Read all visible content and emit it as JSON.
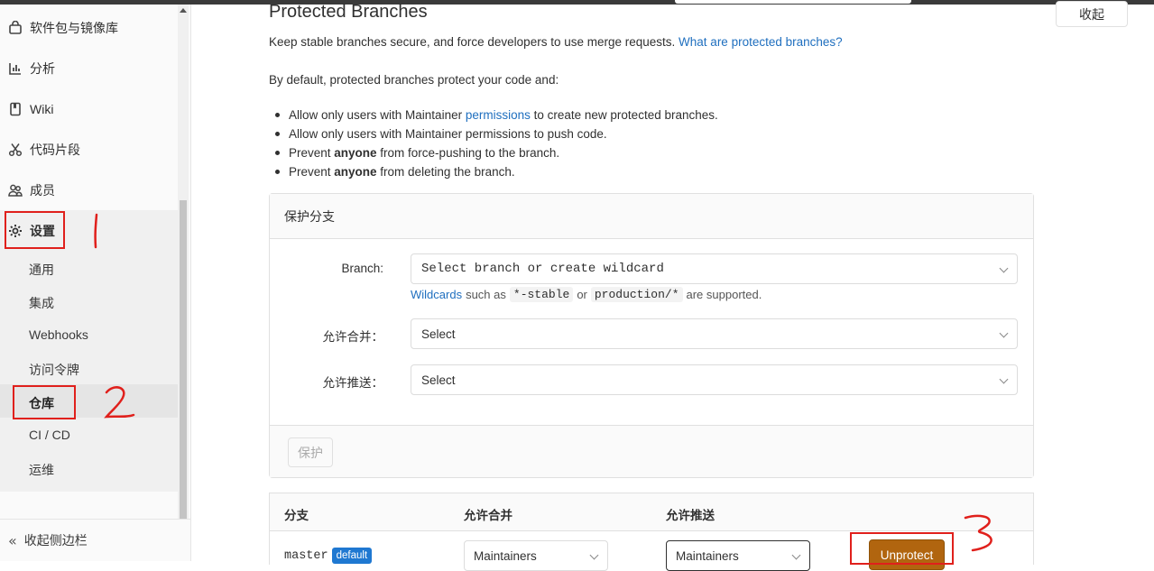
{
  "sidebar": {
    "items": [
      {
        "label": "软件包与镜像库",
        "icon": "package-icon"
      },
      {
        "label": "分析",
        "icon": "chart-icon"
      },
      {
        "label": "Wiki",
        "icon": "book-icon"
      },
      {
        "label": "代码片段",
        "icon": "scissors-icon"
      },
      {
        "label": "成员",
        "icon": "users-icon"
      },
      {
        "label": "设置",
        "icon": "gear-icon"
      }
    ],
    "sub_items": [
      {
        "label": "通用"
      },
      {
        "label": "集成"
      },
      {
        "label": "Webhooks"
      },
      {
        "label": "访问令牌"
      },
      {
        "label": "仓库"
      },
      {
        "label": "CI / CD"
      },
      {
        "label": "运维"
      }
    ],
    "collapse_label": "收起侧边栏"
  },
  "section": {
    "title": "Protected Branches",
    "collapse_button": "收起",
    "description": "Keep stable branches secure, and force developers to use merge requests.",
    "description_link": "What are protected branches?",
    "default_text": "By default, protected branches protect your code and:",
    "rules": [
      {
        "before": "Allow only users with Maintainer ",
        "link": "permissions",
        "after": " to create new protected branches."
      },
      {
        "before": "Allow only users with Maintainer permissions to push code.",
        "bold": "",
        "after": ""
      },
      {
        "before": "Prevent ",
        "bold": "anyone",
        "after": " from force-pushing to the branch."
      },
      {
        "before": "Prevent ",
        "bold": "anyone",
        "after": " from deleting the branch."
      }
    ]
  },
  "form": {
    "header": "保护分支",
    "branch_label": "Branch:",
    "branch_placeholder": "Select branch or create wildcard",
    "hint_link": "Wildcards",
    "hint_text1": "such as",
    "hint_code1": "*-stable",
    "hint_text2": "or",
    "hint_code2": "production/*",
    "hint_text3": "are supported.",
    "merge_label": "允许合并：",
    "merge_value": "Select",
    "push_label": "允许推送：",
    "push_value": "Select",
    "protect_button": "保护"
  },
  "table": {
    "headers": [
      "分支",
      "允许合并",
      "允许推送"
    ],
    "rows": [
      {
        "branch": "master",
        "badge": "default",
        "merge": "Maintainers",
        "push": "Maintainers",
        "action": "Unprotect"
      }
    ]
  },
  "annotations": {
    "color": "#e0201c",
    "numbers": [
      "1",
      "2",
      "3"
    ]
  }
}
